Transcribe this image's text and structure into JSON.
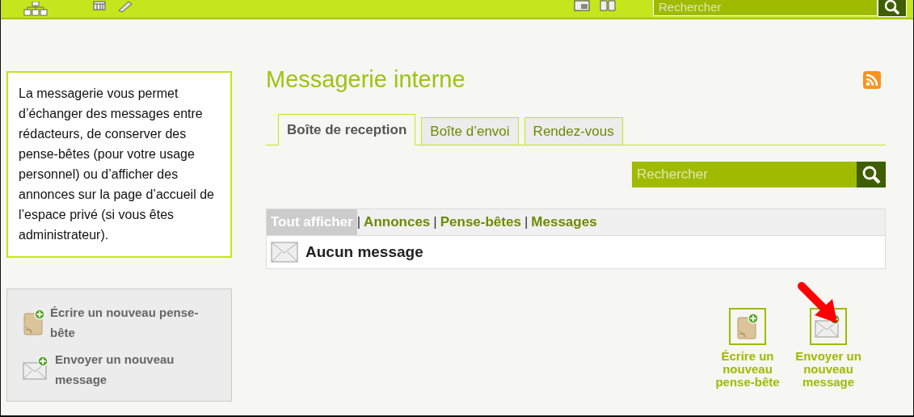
{
  "top_bar": {
    "search": {
      "placeholder": "Rechercher"
    }
  },
  "sidebar": {
    "intro": "La messagerie vous permet d’échanger des messages entre rédacteurs, de conserver des pense-bêtes (pour votre usage personnel) ou d’afficher des annonces sur la page d’accueil de l’espace privé (si vous êtes administrateur).",
    "actions": [
      {
        "kind": "memo",
        "label": "Écrire un nouveau pense-bête"
      },
      {
        "kind": "message",
        "label": "Envoyer un nouveau message"
      }
    ]
  },
  "main": {
    "title": "Messagerie interne",
    "tabs": [
      {
        "label": "Boîte de reception",
        "selected": true
      },
      {
        "label": "Boîte d’envoi",
        "selected": false
      },
      {
        "label": "Rendez-vous",
        "selected": false
      }
    ],
    "search": {
      "placeholder": "Rechercher"
    },
    "filters": [
      {
        "label": "Tout afficher",
        "selected": true
      },
      {
        "separator": "|",
        "label": "Annonces",
        "selected": false
      },
      {
        "separator": "|",
        "label": "Pense-bêtes",
        "selected": false
      },
      {
        "separator": "|",
        "label": "Messages",
        "selected": false
      }
    ],
    "empty_message": "Aucun message",
    "actions": [
      {
        "kind": "memo",
        "label": "Écrire un nouveau pense-bête"
      },
      {
        "kind": "message",
        "label": "Envoyer un nouveau message"
      }
    ]
  }
}
